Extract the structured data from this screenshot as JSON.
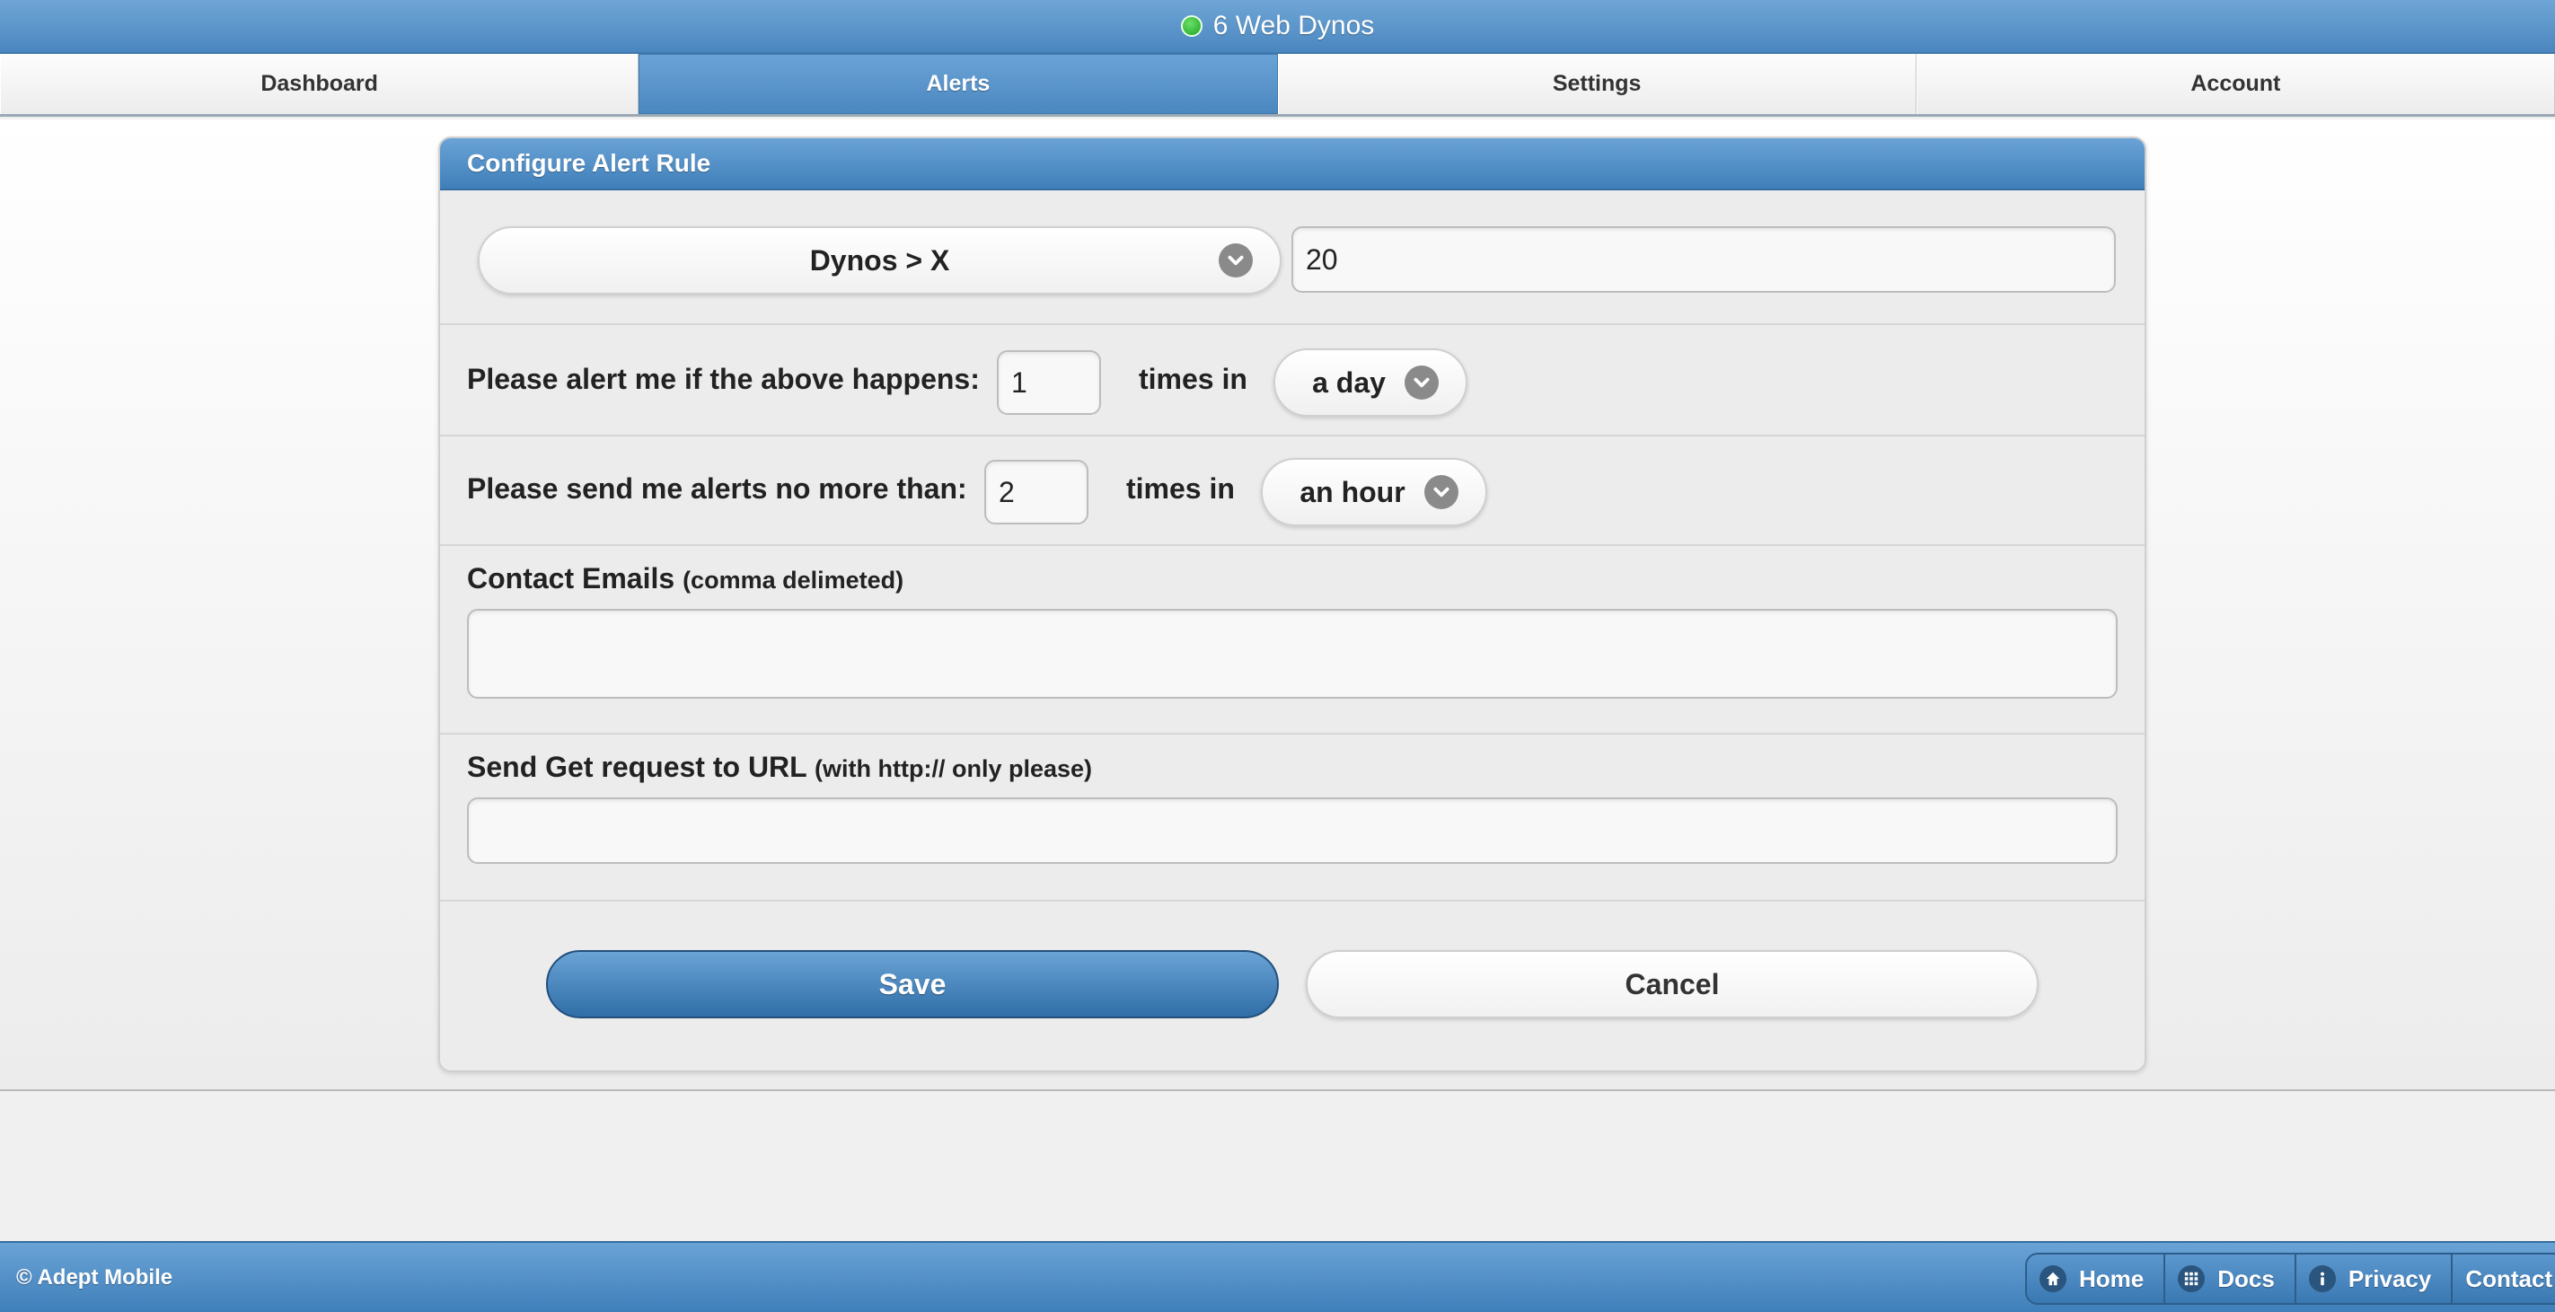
{
  "status_bar": {
    "text": "6 Web Dynos",
    "status_color": "#2fbf2f"
  },
  "nav": {
    "tabs": [
      {
        "label": "Dashboard",
        "active": false
      },
      {
        "label": "Alerts",
        "active": true
      },
      {
        "label": "Settings",
        "active": false
      },
      {
        "label": "Account",
        "active": false
      }
    ]
  },
  "panel": {
    "title": "Configure Alert Rule",
    "rule": {
      "metric_select": "Dynos > X",
      "threshold_value": "20"
    },
    "alert_frequency": {
      "label": "Please alert me if the above happens:",
      "count_value": "1",
      "times_in_label": "times in",
      "period_select": "a day"
    },
    "throttle": {
      "label": "Please send me alerts no more than:",
      "count_value": "2",
      "times_in_label": "times in",
      "period_select": "an hour"
    },
    "contact_emails": {
      "label": "Contact Emails",
      "hint": "(comma delimeted)",
      "value": ""
    },
    "webhook": {
      "label": "Send Get request to URL",
      "hint": "(with http:// only please)",
      "value": ""
    },
    "save_label": "Save",
    "cancel_label": "Cancel"
  },
  "footer": {
    "copyright": "© Adept Mobile",
    "links": [
      {
        "label": "Home",
        "icon": "home-icon"
      },
      {
        "label": "Docs",
        "icon": "grid-icon"
      },
      {
        "label": "Privacy",
        "icon": "info-icon"
      },
      {
        "label": "Contact",
        "icon": ""
      }
    ]
  }
}
